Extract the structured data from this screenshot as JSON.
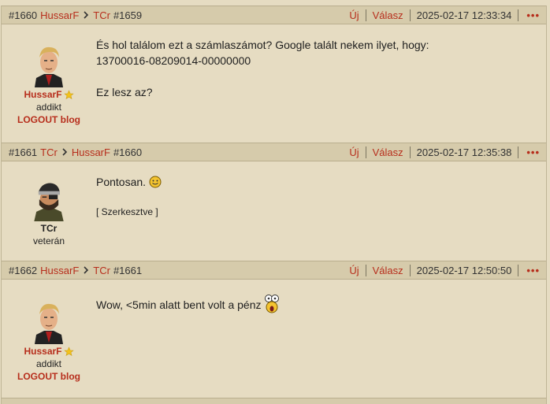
{
  "posts": [
    {
      "num": "#1660",
      "author": "HussarF",
      "reply_to_user": "TCr",
      "reply_to_num": "#1659",
      "actions": {
        "new": "Új",
        "reply": "Válasz"
      },
      "date": "2025-02-17 12:33:34",
      "more": "•••",
      "rank": "addikt",
      "blog": "LOGOUT blog",
      "lines": [
        "És hol találom ezt a számlaszámot? Google talált nekem ilyet, hogy:",
        "13700016-08209014-00000000",
        "",
        "Ez lesz az?"
      ]
    },
    {
      "num": "#1661",
      "author": "TCr",
      "reply_to_user": "HussarF",
      "reply_to_num": "#1660",
      "actions": {
        "new": "Új",
        "reply": "Válasz"
      },
      "date": "2025-02-17 12:35:38",
      "more": "•••",
      "rank": "veterán",
      "text": "Pontosan.",
      "edited": "[ Szerkesztve ]"
    },
    {
      "num": "#1662",
      "author": "HussarF",
      "reply_to_user": "TCr",
      "reply_to_num": "#1661",
      "actions": {
        "new": "Új",
        "reply": "Válasz"
      },
      "date": "2025-02-17 12:50:50",
      "more": "•••",
      "rank": "addikt",
      "blog": "LOGOUT blog",
      "text": "Wow, <5min alatt bent volt a pénz"
    }
  ],
  "colors": {
    "accent": "#b72e1c",
    "background": "#e6dcc2",
    "header": "#d6cbab"
  },
  "icons": {
    "star": "star-icon",
    "smile": "smile-icon",
    "shock": "shocked-smiley-icon"
  }
}
